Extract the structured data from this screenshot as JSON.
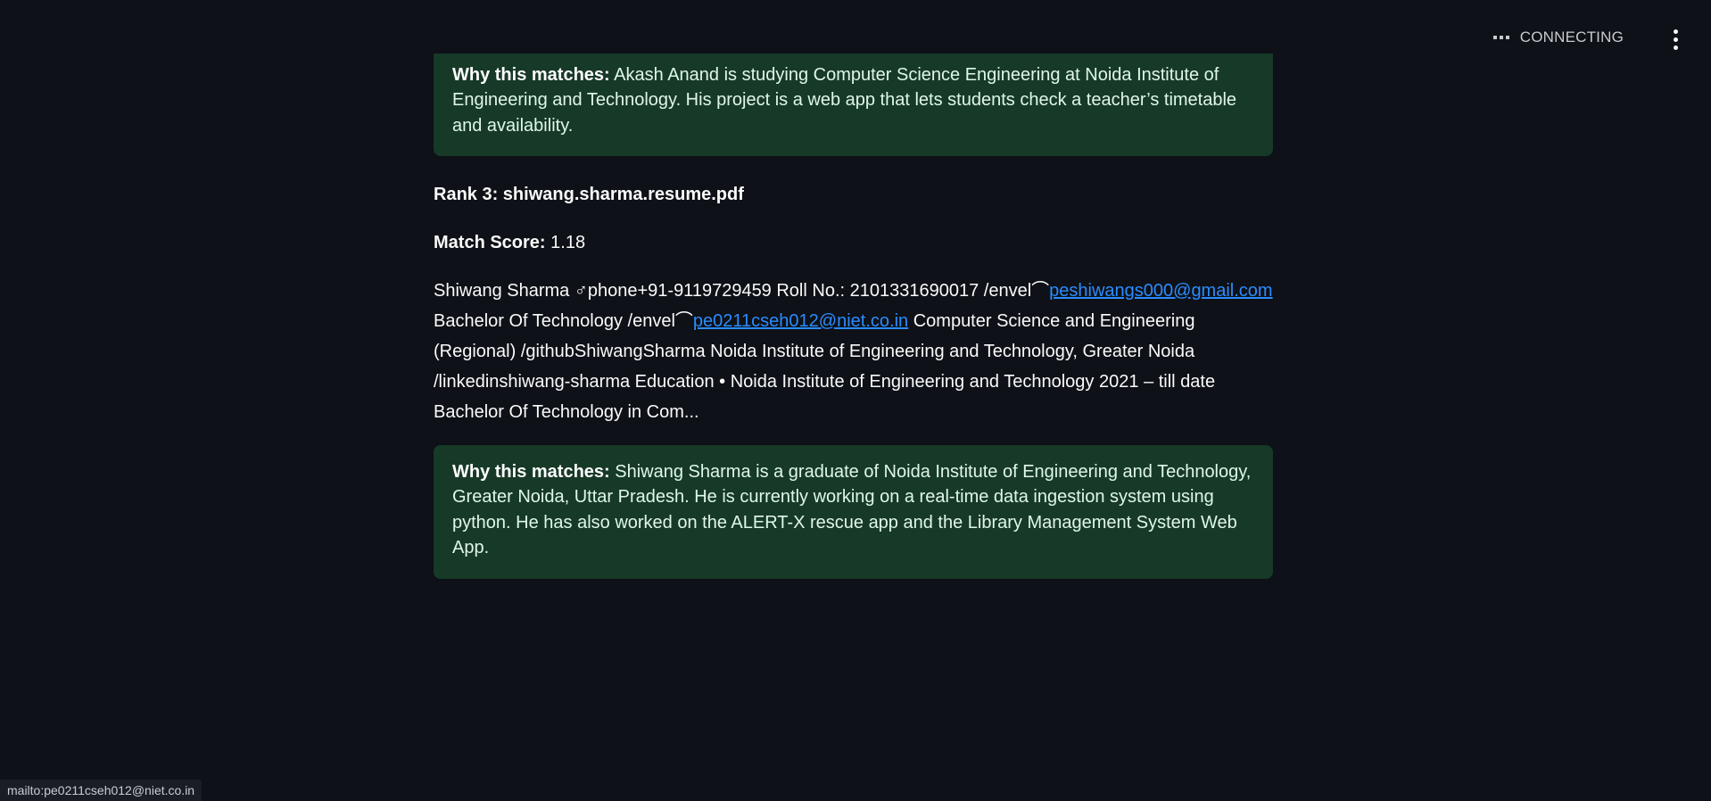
{
  "header": {
    "status_text": "CONNECTING",
    "menu_icon": "vertical-ellipsis"
  },
  "results": {
    "previous_match": {
      "label": "Why this matches:",
      "text": "Akash Anand is studying Computer Science Engineering at Noida Institute of Engineering and Technology. His project is a web app that lets students check a teacher’s timetable and availability."
    },
    "rank3": {
      "title": "Rank 3: shiwang.sharma.resume.pdf",
      "score_label": "Match Score:",
      "score_value": "1.18",
      "resume_text_1": "Shiwang Sharma ♂phone+91-9119729459 Roll No.: 2101331690017 /envel⌒",
      "email1": "peshiwangs000@gmail.com",
      "resume_text_2": "Bachelor Of Technology /envel⌒",
      "email2": "pe0211cseh012@niet.co.in",
      "resume_text_3": " Computer Science and Engineering (Regional) /githubShiwangSharma Noida Institute of Engineering and Technology, Greater Noida /linkedinshiwang-sharma Education • Noida Institute of Engineering and Technology 2021 – till date Bachelor Of Technology in Com...",
      "why_label": "Why this matches:",
      "why_text": "Shiwang Sharma is a graduate of Noida Institute of Engineering and Technology, Greater Noida, Uttar Pradesh. He is currently working on a real-time data ingestion system using python. He has also worked on the ALERT-X rescue app and the Library Management System Web App."
    }
  },
  "browser_status": {
    "hover_url": "mailto:pe0211cseh012@niet.co.in"
  },
  "colors": {
    "background": "#0e1117",
    "match_box": "#173928",
    "link": "#2b8cff"
  }
}
